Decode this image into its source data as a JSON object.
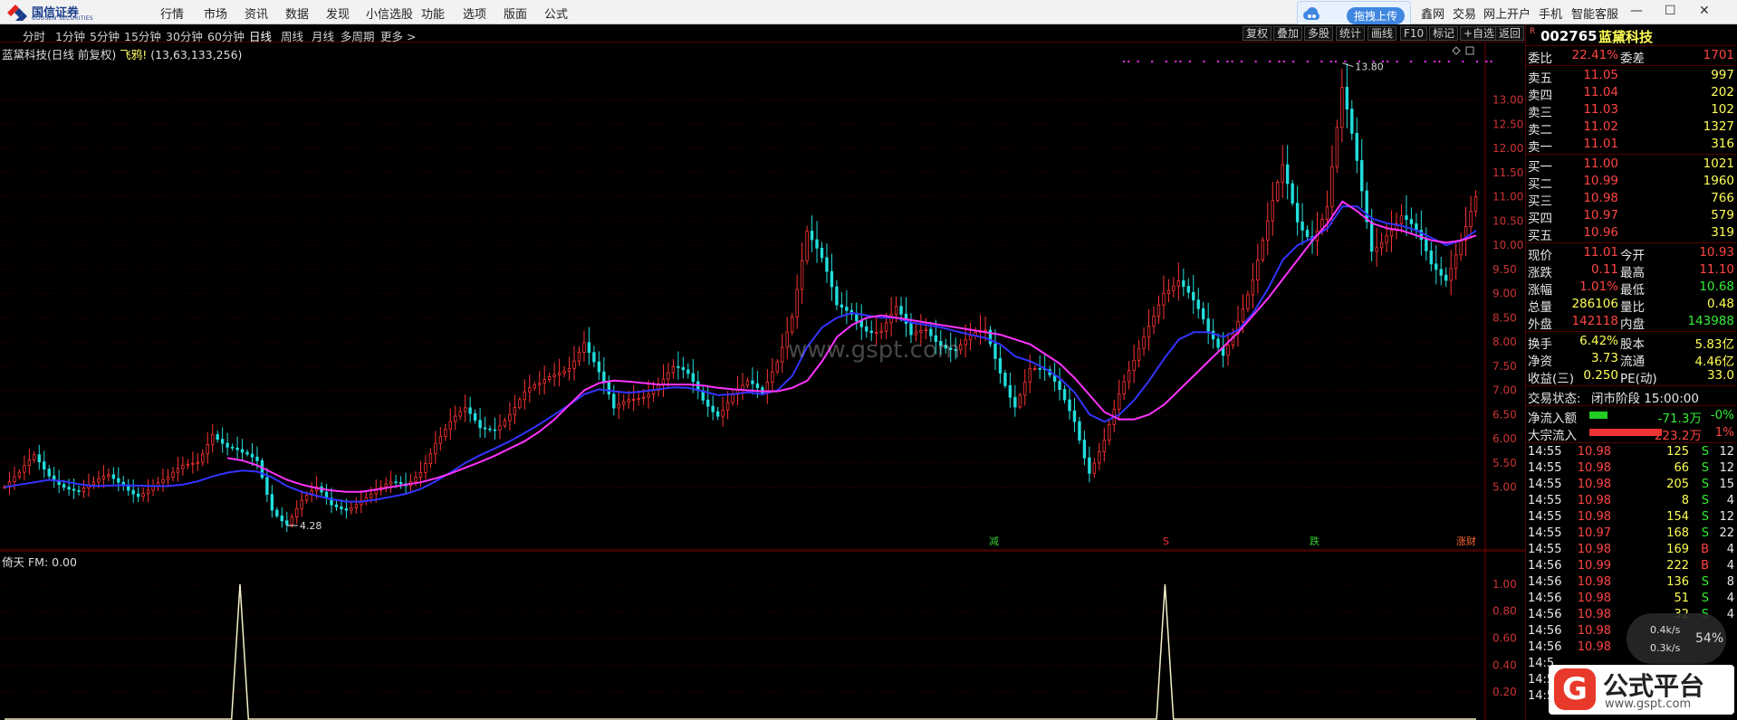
{
  "logo": {
    "name": "国信证券",
    "sub": "GUOSEN SECURITIES"
  },
  "menu": [
    "行情",
    "市场",
    "资讯",
    "数据",
    "发现",
    "小信选股",
    "功能",
    "选项",
    "版面",
    "公式"
  ],
  "upload_label": "拖拽上传",
  "right_menu": [
    "鑫网",
    "交易",
    "网上开户",
    "手机",
    "智能客服"
  ],
  "window_controls": [
    "—",
    "☐",
    "✕"
  ],
  "periods": [
    "分时",
    "1分钟",
    "5分钟",
    "15分钟",
    "30分钟",
    "60分钟",
    "日线",
    "周线",
    "月线",
    "多周期",
    "更多 >"
  ],
  "active_period": "日线",
  "toolbar": [
    "复权",
    "叠加",
    "多股",
    "统计",
    "画线",
    "F10",
    "标记",
    "+自选",
    "返回"
  ],
  "chart_title": {
    "name": "蓝黛科技(日线 前复权)",
    "flag": "飞鸦!",
    "params": "(13,63,133,256)"
  },
  "indicator_title": "倚天  FM: 0.00",
  "watermark": "www.gspt.com",
  "stock": {
    "flag": "R",
    "code": "002765",
    "name": "蓝黛科技"
  },
  "weibi": {
    "label": "委比",
    "value": "22.41%",
    "label2": "委差",
    "value2": "1701"
  },
  "sell": [
    {
      "label": "卖五",
      "price": "11.05",
      "vol": "997"
    },
    {
      "label": "卖四",
      "price": "11.04",
      "vol": "202"
    },
    {
      "label": "卖三",
      "price": "11.03",
      "vol": "102"
    },
    {
      "label": "卖二",
      "price": "11.02",
      "vol": "1327"
    },
    {
      "label": "卖一",
      "price": "11.01",
      "vol": "316"
    }
  ],
  "buy": [
    {
      "label": "买一",
      "price": "11.00",
      "vol": "1021"
    },
    {
      "label": "买二",
      "price": "10.99",
      "vol": "1960"
    },
    {
      "label": "买三",
      "price": "10.98",
      "vol": "766"
    },
    {
      "label": "买四",
      "price": "10.97",
      "vol": "579"
    },
    {
      "label": "买五",
      "price": "10.96",
      "vol": "319"
    }
  ],
  "quote": [
    {
      "l1": "现价",
      "v1": "11.01",
      "c1": "red",
      "l2": "今开",
      "v2": "10.93",
      "c2": "red"
    },
    {
      "l1": "涨跌",
      "v1": "0.11",
      "c1": "red",
      "l2": "最高",
      "v2": "11.10",
      "c2": "red"
    },
    {
      "l1": "涨幅",
      "v1": "1.01%",
      "c1": "red",
      "l2": "最低",
      "v2": "10.68",
      "c2": "green"
    },
    {
      "l1": "总量",
      "v1": "286106",
      "c1": "yellow",
      "l2": "量比",
      "v2": "0.48",
      "c2": "yellow"
    },
    {
      "l1": "外盘",
      "v1": "142118",
      "c1": "red",
      "l2": "内盘",
      "v2": "143988",
      "c2": "green"
    }
  ],
  "fund": [
    {
      "l1": "换手",
      "v1": "6.42%",
      "l2": "股本",
      "v2": "5.83亿"
    },
    {
      "l1": "净资",
      "v1": "3.73",
      "l2": "流通",
      "v2": "4.46亿"
    },
    {
      "l1": "收益(三)",
      "v1": "0.250",
      "l2": "PE(动)",
      "v2": "33.0"
    }
  ],
  "status": {
    "label": "交易状态:",
    "value": "闭市阶段 15:00:00"
  },
  "flow": [
    {
      "label": "净流入额",
      "value": "-71.3万",
      "pct": "-0%",
      "color": "green",
      "bar": 0.25
    },
    {
      "label": "大宗流入",
      "value": "223.2万",
      "pct": "1%",
      "color": "red",
      "bar": 1.0
    }
  ],
  "ticks": [
    {
      "t": "14:55",
      "p": "10.98",
      "v": "125",
      "s": "S",
      "n": "12"
    },
    {
      "t": "14:55",
      "p": "10.98",
      "v": "66",
      "s": "S",
      "n": "12"
    },
    {
      "t": "14:55",
      "p": "10.98",
      "v": "205",
      "s": "S",
      "n": "15"
    },
    {
      "t": "14:55",
      "p": "10.98",
      "v": "8",
      "s": "S",
      "n": "4"
    },
    {
      "t": "14:55",
      "p": "10.98",
      "v": "154",
      "s": "S",
      "n": "12"
    },
    {
      "t": "14:55",
      "p": "10.97",
      "v": "168",
      "s": "S",
      "n": "22"
    },
    {
      "t": "14:55",
      "p": "10.98",
      "v": "169",
      "s": "B",
      "n": "4"
    },
    {
      "t": "14:56",
      "p": "10.99",
      "v": "222",
      "s": "B",
      "n": "4"
    },
    {
      "t": "14:56",
      "p": "10.98",
      "v": "136",
      "s": "S",
      "n": "8"
    },
    {
      "t": "14:56",
      "p": "10.98",
      "v": "51",
      "s": "S",
      "n": "4"
    },
    {
      "t": "14:56",
      "p": "10.98",
      "v": "32",
      "s": "S",
      "n": "4"
    },
    {
      "t": "14:56",
      "p": "10.98",
      "v": "",
      "s": "",
      "n": ""
    },
    {
      "t": "14:56",
      "p": "10.98",
      "v": "",
      "s": "",
      "n": ""
    },
    {
      "t": "14:5",
      "p": "",
      "v": "",
      "s": "",
      "n": ""
    },
    {
      "t": "14:5",
      "p": "",
      "v": "",
      "s": "",
      "n": ""
    },
    {
      "t": "14:5",
      "p": "",
      "v": "",
      "s": "",
      "n": ""
    }
  ],
  "speed": {
    "up": "0.4k/s",
    "down": "0.3k/s",
    "pct": "54%"
  },
  "gspt": {
    "glyph": "G",
    "title": "公式平台",
    "url": "www.gspt.com"
  },
  "colors": {
    "up": "#ff3333",
    "down": "#22dddd",
    "ma1": "#ff33ff",
    "ma2": "#3333ff"
  },
  "chart_data": [
    {
      "type": "candlestick",
      "title": "蓝黛科技(日线 前复权)",
      "y_ticks": [
        "13.00",
        "12.50",
        "12.00",
        "11.50",
        "11.00",
        "10.50",
        "10.00",
        "9.50",
        "9.00",
        "8.50",
        "8.00",
        "7.50",
        "7.00",
        "6.50",
        "6.00",
        "5.50",
        "5.00"
      ],
      "ylim": [
        4.0,
        14.0
      ],
      "annotations": [
        {
          "label": "13.80",
          "value": 13.8,
          "kind": "high"
        },
        {
          "label": "4.28",
          "value": 4.28,
          "kind": "low"
        }
      ],
      "signal_labels": [
        "减",
        "S",
        "跌",
        "涨财"
      ],
      "series": [
        {
          "values": [
            5.0,
            5.2,
            5.6,
            5.3,
            5.1,
            4.9,
            5.0,
            5.2,
            5.1,
            4.9,
            5.0,
            5.1,
            5.4,
            5.6,
            6.2,
            5.8,
            5.6,
            5.5,
            4.6,
            4.3,
            4.7,
            4.9,
            4.6,
            4.6,
            4.8,
            4.9,
            5.0,
            5.0,
            5.4,
            6.0,
            6.3,
            6.5,
            6.2,
            6.3,
            6.6,
            6.9,
            7.0,
            7.3,
            7.6,
            8.1,
            7.3,
            6.5,
            6.8,
            7.0,
            7.2,
            7.4,
            7.2,
            6.8,
            6.6,
            7.0,
            7.1,
            6.8,
            7.6,
            8.7,
            10.4,
            9.6,
            8.6,
            8.6,
            8.4,
            8.3,
            8.6,
            8.0,
            8.3,
            8.1,
            7.9,
            8.0,
            8.1,
            7.4,
            6.8,
            7.5,
            7.3,
            6.9,
            6.4,
            5.4,
            6.0,
            6.8,
            7.5,
            8.4,
            9.2,
            9.3,
            8.7,
            8.1,
            7.8,
            8.6,
            9.3,
            10.3,
            11.5,
            10.6,
            10.3,
            10.8,
            13.0,
            11.6,
            10.0,
            10.4,
            10.6,
            10.1,
            9.5,
            9.4,
            10.3,
            11.0
          ]
        },
        {
          "name": "MA",
          "values": [
            5.0,
            5.05,
            5.1,
            5.15,
            5.12,
            5.06,
            5.02,
            5.03,
            5.04,
            5.03,
            5.02,
            5.02,
            5.05,
            5.12,
            5.22,
            5.3,
            5.34,
            5.32,
            5.2,
            5.02,
            4.9,
            4.82,
            4.75,
            4.7,
            4.7,
            4.74,
            4.8,
            4.86,
            4.96,
            5.12,
            5.3,
            5.5,
            5.66,
            5.8,
            5.95,
            6.12,
            6.3,
            6.5,
            6.7,
            6.92,
            7.02,
            6.98,
            6.95,
            6.98,
            7.02,
            7.06,
            7.05,
            6.98,
            6.9,
            6.92,
            6.96,
            6.92,
            7.0,
            7.3,
            7.9,
            8.3,
            8.5,
            8.6,
            8.55,
            8.5,
            8.5,
            8.4,
            8.35,
            8.3,
            8.22,
            8.15,
            8.08,
            7.95,
            7.7,
            7.6,
            7.45,
            7.25,
            6.95,
            6.5,
            6.35,
            6.5,
            6.8,
            7.2,
            7.65,
            8.05,
            8.2,
            8.2,
            8.1,
            8.25,
            8.6,
            9.1,
            9.7,
            10.0,
            10.15,
            10.35,
            10.8,
            10.8,
            10.55,
            10.45,
            10.4,
            10.3,
            10.15,
            10.0,
            10.1,
            10.3
          ]
        },
        {
          "name": "MA",
          "values": [
            null,
            null,
            null,
            null,
            null,
            null,
            null,
            null,
            null,
            null,
            null,
            null,
            null,
            null,
            null,
            5.6,
            5.55,
            5.45,
            5.3,
            5.15,
            5.05,
            4.98,
            4.93,
            4.9,
            4.9,
            4.95,
            5.0,
            5.05,
            5.1,
            5.18,
            5.28,
            5.4,
            5.52,
            5.65,
            5.8,
            5.95,
            6.15,
            6.4,
            6.7,
            7.0,
            7.15,
            7.2,
            7.18,
            7.15,
            7.12,
            7.12,
            7.12,
            7.1,
            7.05,
            7.02,
            7.0,
            6.98,
            6.98,
            7.05,
            7.2,
            7.6,
            8.1,
            8.35,
            8.5,
            8.55,
            8.5,
            8.45,
            8.4,
            8.35,
            8.3,
            8.25,
            8.2,
            8.15,
            8.05,
            7.95,
            7.75,
            7.55,
            7.25,
            6.9,
            6.55,
            6.4,
            6.4,
            6.5,
            6.7,
            7.0,
            7.3,
            7.6,
            7.9,
            8.2,
            8.55,
            8.9,
            9.3,
            9.7,
            10.1,
            10.45,
            10.9,
            10.7,
            10.45,
            10.35,
            10.3,
            10.2,
            10.1,
            10.05,
            10.1,
            10.2
          ]
        }
      ]
    },
    {
      "type": "line",
      "title": "倚天",
      "y_ticks": [
        "1.00",
        "0.80",
        "0.60",
        "0.40",
        "0.20"
      ],
      "ylim": [
        0,
        1.1
      ],
      "series": [
        {
          "name": "FM",
          "values": [
            0,
            0,
            0,
            0,
            0,
            0,
            0,
            0,
            0,
            0,
            0,
            0,
            0,
            0,
            0,
            0,
            0,
            0,
            0,
            0,
            0,
            0,
            0,
            0,
            0,
            0,
            0,
            0,
            1,
            0,
            0,
            0,
            0,
            0,
            0,
            0,
            0,
            0,
            0,
            0,
            0,
            0,
            0,
            0,
            0,
            0,
            0,
            0,
            0,
            0,
            0,
            0,
            0,
            0,
            0,
            0,
            0,
            0,
            0,
            0,
            0,
            0,
            0,
            0,
            0,
            0,
            0,
            0,
            0,
            0,
            0,
            0,
            0,
            0,
            0,
            0,
            0,
            0,
            0,
            0,
            0,
            0,
            0,
            0,
            0,
            0,
            0,
            0,
            0,
            0,
            0,
            0,
            0,
            0,
            0,
            0,
            0,
            0,
            0,
            0,
            0,
            0,
            0,
            0,
            0,
            0,
            0,
            0,
            0,
            0,
            0,
            0,
            0,
            0,
            0,
            0,
            0,
            0,
            0,
            0,
            0,
            0,
            0,
            0,
            0,
            0,
            0,
            0,
            0,
            0,
            0,
            0,
            0,
            0,
            0,
            0,
            0,
            0,
            1,
            0,
            0,
            0,
            0,
            0,
            0,
            0,
            0,
            0,
            0,
            0,
            0,
            0,
            0,
            0,
            0,
            0,
            0,
            0,
            0,
            0,
            0,
            0,
            0,
            0,
            0,
            0,
            0,
            0,
            0,
            0,
            0,
            0,
            0,
            0,
            0,
            0
          ]
        }
      ]
    }
  ]
}
